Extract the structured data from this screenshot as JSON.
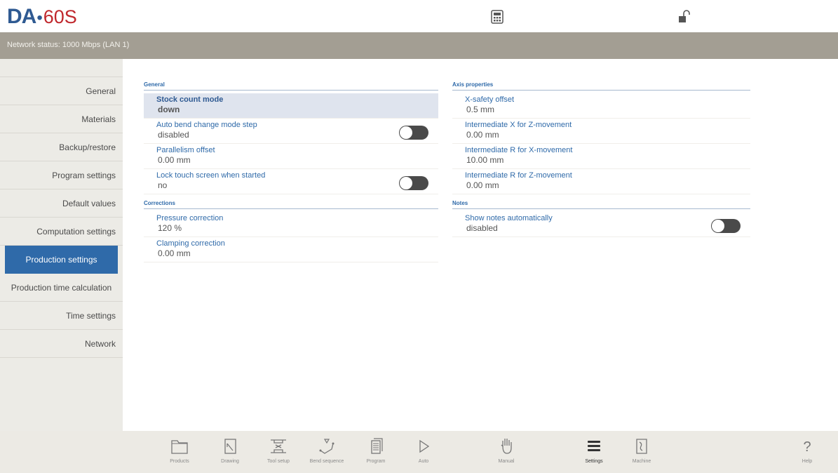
{
  "header": {
    "logo_brand": "DA",
    "logo_model": "60S",
    "calculator_icon": "calculator-icon",
    "lock_icon": "unlock-icon"
  },
  "status": {
    "text": "Network status: 1000 Mbps (LAN 1)"
  },
  "sidebar": {
    "items": [
      {
        "label": "General"
      },
      {
        "label": "Materials"
      },
      {
        "label": "Backup/restore"
      },
      {
        "label": "Program settings"
      },
      {
        "label": "Default values"
      },
      {
        "label": "Computation settings"
      },
      {
        "label": "Production settings"
      },
      {
        "label": "Production time calculation"
      },
      {
        "label": "Time settings"
      },
      {
        "label": "Network"
      }
    ],
    "active": "Production settings"
  },
  "general": {
    "title": "General",
    "stock_count_mode": {
      "label": "Stock count mode",
      "value": "down"
    },
    "auto_bend": {
      "label": "Auto bend change mode step",
      "value": "disabled"
    },
    "parallelism": {
      "label": "Parallelism offset",
      "value": "0.00 mm"
    },
    "lock_touch": {
      "label": "Lock touch screen when started",
      "value": "no"
    }
  },
  "corrections": {
    "title": "Corrections",
    "pressure": {
      "label": "Pressure correction",
      "value": "120 %"
    },
    "clamping": {
      "label": "Clamping correction",
      "value": "0.00 mm"
    }
  },
  "axis": {
    "title": "Axis properties",
    "x_safety": {
      "label": "X-safety offset",
      "value": "0.5 mm"
    },
    "inter_x_z": {
      "label": "Intermediate X for Z-movement",
      "value": "0.00 mm"
    },
    "inter_r_x": {
      "label": "Intermediate R for X-movement",
      "value": "10.00 mm"
    },
    "inter_r_z": {
      "label": "Intermediate R for Z-movement",
      "value": "0.00 mm"
    }
  },
  "notes": {
    "title": "Notes",
    "show_notes": {
      "label": "Show notes automatically",
      "value": "disabled"
    }
  },
  "tabs": {
    "products": "Products",
    "drawing": "Drawing",
    "tool_setup": "Tool setup",
    "bend_sequence": "Bend sequence",
    "program": "Program",
    "auto": "Auto",
    "manual": "Manual",
    "settings": "Settings",
    "machine": "Machine",
    "help": "Help",
    "active": "Settings"
  },
  "colors": {
    "accent": "#2f6aa9",
    "statusbar": "#a39e93",
    "sidebar": "#ecebe6",
    "highlight_row": "#dfe4ee",
    "logo_red": "#c0282d"
  }
}
